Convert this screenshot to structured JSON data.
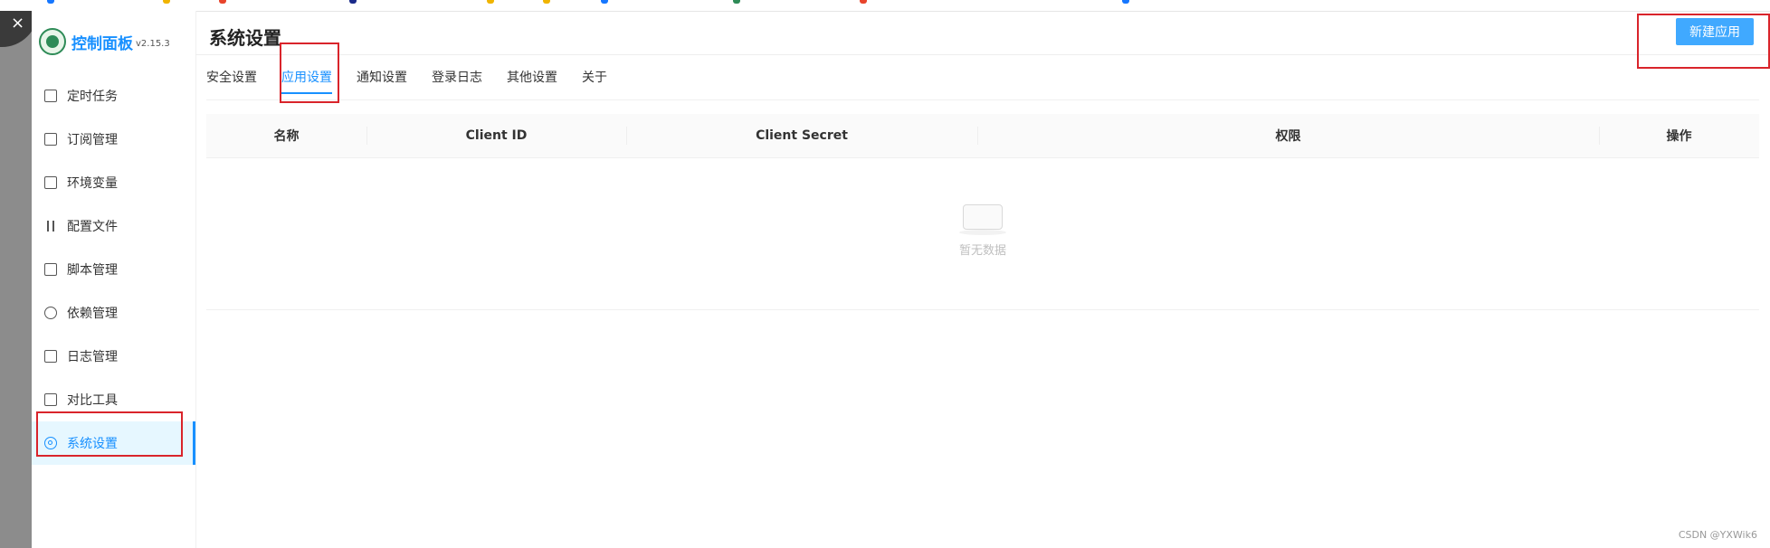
{
  "topstrip": {
    "colors": [
      "#1677ff",
      "#f0b400",
      "#e8442c",
      "#1a2a8a",
      "#555555",
      "#f0b400",
      "#f0b400",
      "#1677ff",
      "#1677ff",
      "#2e8b57",
      "#555555",
      "#e8442c",
      "#1677ff",
      "#1677ff"
    ]
  },
  "window": {
    "close_glyph": "×"
  },
  "app": {
    "title": "控制面板",
    "version": "v2.15.3"
  },
  "sidebar": {
    "items": [
      {
        "label": "定时任务",
        "icon": "calendar-icon",
        "active": false
      },
      {
        "label": "订阅管理",
        "icon": "subscription-icon",
        "active": false
      },
      {
        "label": "环境变量",
        "icon": "monitor-icon",
        "active": false
      },
      {
        "label": "配置文件",
        "icon": "sliders-icon",
        "active": false
      },
      {
        "label": "脚本管理",
        "icon": "script-icon",
        "active": false
      },
      {
        "label": "依赖管理",
        "icon": "dependency-icon",
        "active": false
      },
      {
        "label": "日志管理",
        "icon": "log-icon",
        "active": false
      },
      {
        "label": "对比工具",
        "icon": "book-icon",
        "active": false
      },
      {
        "label": "系统设置",
        "icon": "gear-icon",
        "active": true
      }
    ]
  },
  "header": {
    "title": "系统设置",
    "new_app_button": "新建应用"
  },
  "tabs": [
    {
      "label": "安全设置",
      "active": false
    },
    {
      "label": "应用设置",
      "active": true
    },
    {
      "label": "通知设置",
      "active": false
    },
    {
      "label": "登录日志",
      "active": false
    },
    {
      "label": "其他设置",
      "active": false
    },
    {
      "label": "关于",
      "active": false
    }
  ],
  "table": {
    "columns": [
      "名称",
      "Client ID",
      "Client Secret",
      "权限",
      "操作"
    ],
    "empty_text": "暂无数据"
  },
  "watermark": "CSDN @YXWik6",
  "colors": {
    "primary": "#1890ff",
    "button": "#40a9ff",
    "annotation": "#d9242b"
  }
}
